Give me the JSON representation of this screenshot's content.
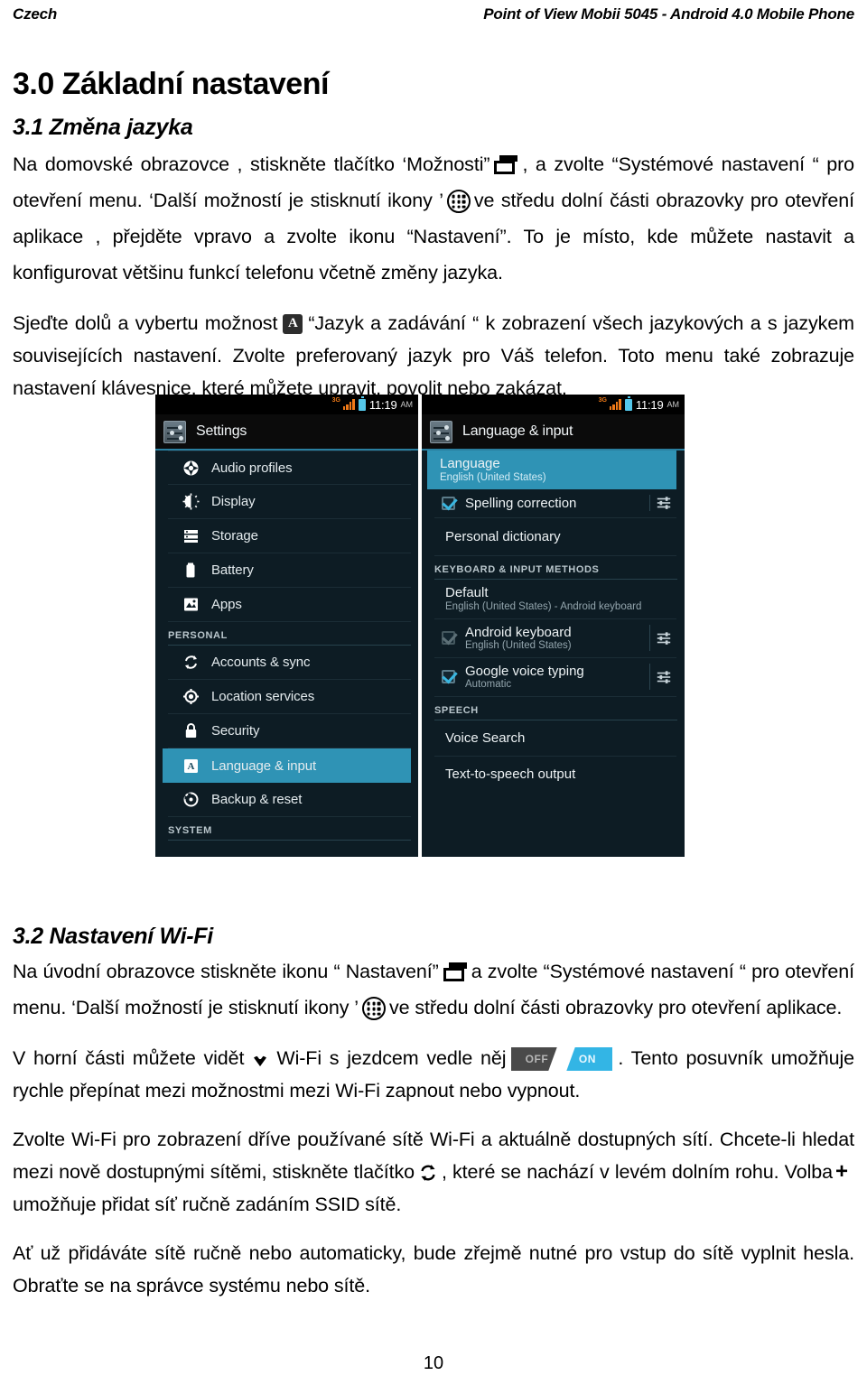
{
  "runhead": {
    "left": "Czech",
    "right": "Point of View Mobii 5045 - Android 4.0 Mobile Phone"
  },
  "section": {
    "heading": "3.0 Základní nastavení"
  },
  "sec31": {
    "heading": "3.1 Změna jazyka",
    "p1_a": "Na domovské obrazovce , stiskněte tlačítko  ‘Možnosti”",
    "p1_b": ", a zvolte “Systémové nastavení “ pro otevření menu. ‘Další možností je stisknutí  ikony ’",
    "p1_c": "ve středu dolní části obrazovky pro otevření  aplikace , přejděte vpravo a zvolte ikonu “Nastavení”. To je místo, kde můžete nastavit a konfigurovat většinu funkcí telefonu včetně změny jazyka.",
    "p2_a": "Sjeďte dolů a vybertu možnost",
    "p2_b": "“Jazyk a zadávání “ k zobrazení všech jazykových a s jazykem souvisejících nastavení. Zvolte preferovaný jazyk pro Váš telefon. Toto menu také zobrazuje nastavení klávesnice, které můžete upravit, povolit nebo zakázat.",
    "lang_badge": "A"
  },
  "sec32": {
    "heading": "3.2 Nastavení  Wi-Fi",
    "p1_a": "Na úvodní obrazovce stiskněte ikonu “ Nastavení”",
    "p1_b": "a zvolte “Systémové nastavení “ pro otevření menu. ‘Další možností je stisknutí  ikony ’",
    "p1_c": "ve středu dolní části obrazovky pro otevření  aplikace.",
    "p2_a": "V horní části můžete vidět",
    "p2_b": "Wi-Fi s jezdcem vedle něj",
    "p2_c": ". Tento posuvník umožňuje rychle přepínat mezi možnostmi mezi Wi-Fi zapnout nebo vypnout.",
    "p3_a": "Zvolte Wi-Fi pro zobrazení dříve používané sítě Wi-Fi a aktuálně dostupných sítí. Chcete-li hledat mezi nově dostupnými sítěmi, stiskněte tlačítko",
    "p3_b": ", které se nachází v levém dolním rohu. Volba",
    "p3_c": "umožňuje přidat síť ručně zadáním SSID sítě.",
    "p4": "Ať už přidáváte sítě ručně nebo automaticky, bude zřejmě nutné pro vstup do sítě vyplnit hesla. Obraťte se na správce systému nebo sítě.",
    "toggle": {
      "off": "OFF",
      "on": "ON"
    }
  },
  "screenshot_left": {
    "statusbar": {
      "network": "3G",
      "time": "11:19",
      "ampm": "AM"
    },
    "title": "Settings",
    "rows": [
      {
        "label": "Audio profiles",
        "icon": "audio-profiles-icon"
      },
      {
        "label": "Display",
        "icon": "display-icon"
      },
      {
        "label": "Storage",
        "icon": "storage-icon"
      },
      {
        "label": "Battery",
        "icon": "battery-icon"
      },
      {
        "label": "Apps",
        "icon": "apps-icon"
      }
    ],
    "personal_header": "PERSONAL",
    "personal_rows": [
      {
        "label": "Accounts & sync",
        "icon": "sync-icon",
        "selected": false
      },
      {
        "label": "Location services",
        "icon": "location-icon",
        "selected": false
      },
      {
        "label": "Security",
        "icon": "lock-icon",
        "selected": false
      },
      {
        "label": "Language & input",
        "icon": "language-icon",
        "selected": true
      },
      {
        "label": "Backup & reset",
        "icon": "backup-reset-icon",
        "selected": false
      }
    ],
    "system_header": "SYSTEM"
  },
  "screenshot_right": {
    "statusbar": {
      "network": "3G",
      "time": "11:19",
      "ampm": "AM"
    },
    "title": "Language & input",
    "language_row": {
      "title": "Language",
      "subtitle": "English (United States)"
    },
    "spelling_row": {
      "label": "Spelling correction",
      "checked": true
    },
    "personal_dictionary": "Personal dictionary",
    "keyboard_header": "KEYBOARD & INPUT METHODS",
    "default_row": {
      "title": "Default",
      "subtitle": "English (United States) - Android keyboard"
    },
    "android_keyboard": {
      "title": "Android keyboard",
      "subtitle": "English (United States)",
      "checked": true,
      "dim": true
    },
    "google_voice": {
      "title": "Google voice typing",
      "subtitle": "Automatic",
      "checked": true,
      "dim": false
    },
    "speech_header": "SPEECH",
    "voice_search": "Voice Search",
    "tts_output": "Text-to-speech output"
  },
  "footer": {
    "page_number": "10"
  },
  "colors": {
    "accent_blue": "#33b5e5",
    "selection": "#2f93b5",
    "phone_bg": "#0d1c24",
    "statusbar_bg": "#000000",
    "signal_orange": "#f07a18",
    "battery_blue": "#54c7ea"
  }
}
